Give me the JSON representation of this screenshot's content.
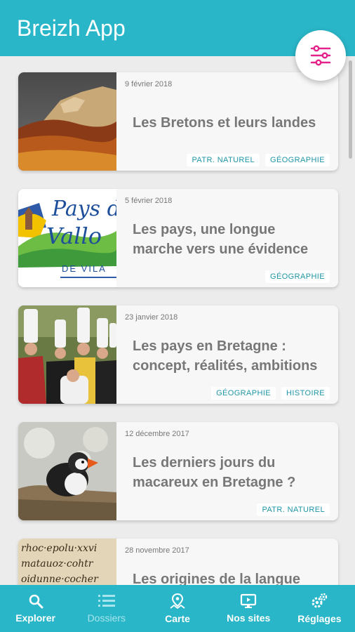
{
  "app": {
    "title": "Breizh App"
  },
  "fab": {
    "icon": "filter-sliders-icon"
  },
  "articles": [
    {
      "date": "9 février 2018",
      "title": "Les Bretons et leurs landes",
      "tags": [
        "PATR. NATUREL",
        "GÉOGRAPHIE"
      ]
    },
    {
      "date": "5 février 2018",
      "title": "Les pays, une longue marche vers une évidence",
      "tags": [
        "GÉOGRAPHIE"
      ],
      "thumb_text": [
        "Pays d",
        "Vallo",
        "DE VILA"
      ]
    },
    {
      "date": "23 janvier 2018",
      "title": "Les pays en Bretagne : concept, réalités, ambitions",
      "tags": [
        "GÉOGRAPHIE",
        "HISTOIRE"
      ]
    },
    {
      "date": "12 décembre 2017",
      "title": "Les derniers jours du macareux en Bretagne ?",
      "tags": [
        "PATR. NATUREL"
      ]
    },
    {
      "date": "28 novembre 2017",
      "title": "Les origines de la langue",
      "tags": [],
      "thumb_text": [
        "rhoc·epolu·xxvi",
        "matauoz·cohtr",
        "oidunne·cocher"
      ]
    }
  ],
  "nav": [
    {
      "label": "Explorer",
      "icon": "search-icon",
      "active": false
    },
    {
      "label": "Dossiers",
      "icon": "list-icon",
      "active": true
    },
    {
      "label": "Carte",
      "icon": "map-pin-icon",
      "active": false
    },
    {
      "label": "Nos sites",
      "icon": "monitor-icon",
      "active": false
    },
    {
      "label": "Réglages",
      "icon": "gears-icon",
      "active": false
    }
  ],
  "colors": {
    "primary": "#29b6c8",
    "accent": "#e5238a",
    "tag_text": "#1f95a6"
  }
}
